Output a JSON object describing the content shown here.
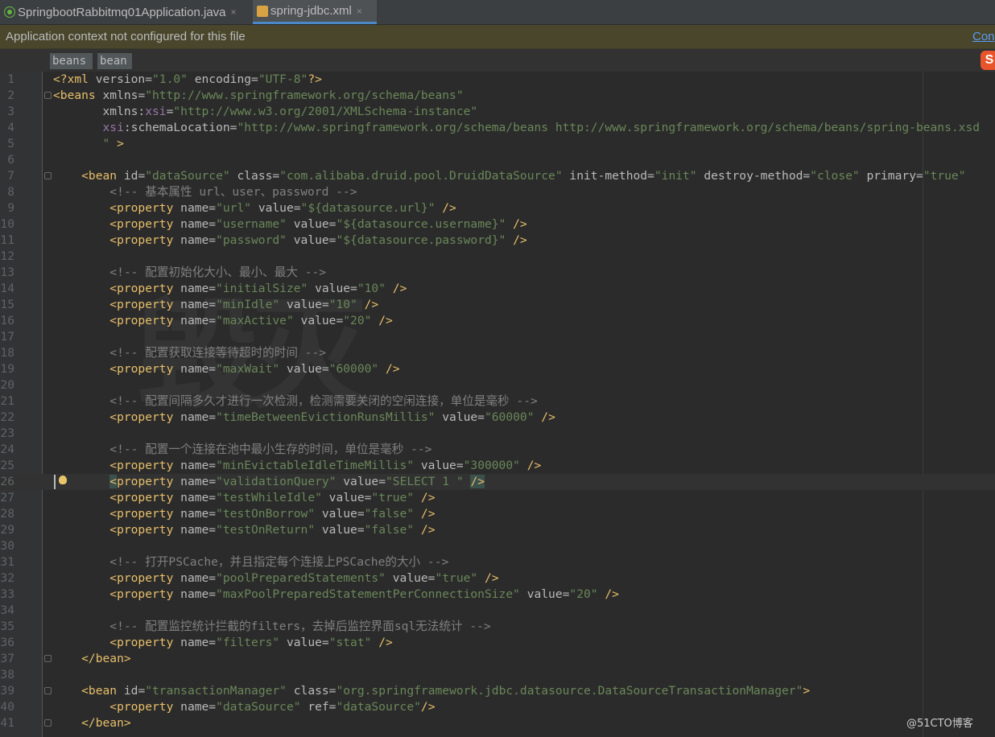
{
  "tabs": [
    {
      "label": "SpringbootRabbitmq01Application.java",
      "icon": "spring-boot-icon",
      "close": "×"
    },
    {
      "label": "spring-jdbc.xml",
      "icon": "xml-file-icon",
      "close": "×"
    }
  ],
  "notification": {
    "text": "Application context not configured for this file",
    "link": "Con"
  },
  "breadcrumbs": [
    "beans",
    "bean"
  ],
  "sogou_label": "S",
  "watermark_text": "毁灭",
  "credit": "@51CTO博客",
  "code_lines": [
    {
      "n": "1",
      "toks": [
        [
          "tag",
          "<?xml "
        ],
        [
          "attr",
          "version="
        ],
        [
          "val",
          "\"1.0\""
        ],
        [
          "attr",
          " encoding="
        ],
        [
          "val",
          "\"UTF-8\""
        ],
        [
          "tag",
          "?>"
        ]
      ]
    },
    {
      "n": "2",
      "fold": true,
      "toks": [
        [
          "tag",
          "<beans "
        ],
        [
          "attr",
          "xmlns="
        ],
        [
          "val",
          "\"http://www.springframework.org/schema/beans\""
        ]
      ]
    },
    {
      "n": "3",
      "toks": [
        [
          "attr",
          "       xmlns:"
        ],
        [
          "ns",
          "xsi"
        ],
        [
          "attr",
          "="
        ],
        [
          "val",
          "\"http://www.w3.org/2001/XMLSchema-instance\""
        ]
      ]
    },
    {
      "n": "4",
      "toks": [
        [
          "ns",
          "       xsi"
        ],
        [
          "attr",
          ":schemaLocation="
        ],
        [
          "val",
          "\"http://www.springframework.org/schema/beans http://www.springframework.org/schema/beans/spring-beans.xsd"
        ]
      ]
    },
    {
      "n": "5",
      "toks": [
        [
          "val",
          "       \" "
        ],
        [
          "tag",
          ">"
        ]
      ]
    },
    {
      "n": "6",
      "toks": []
    },
    {
      "n": "7",
      "fold": true,
      "toks": [
        [
          "tag",
          "    <bean "
        ],
        [
          "attr",
          "id="
        ],
        [
          "val",
          "\"dataSource\""
        ],
        [
          "attr",
          " class="
        ],
        [
          "val",
          "\"com.alibaba.druid.pool.DruidDataSource\""
        ],
        [
          "attr",
          " init-method="
        ],
        [
          "val",
          "\"init\""
        ],
        [
          "attr",
          " destroy-method="
        ],
        [
          "val",
          "\"close\""
        ],
        [
          "attr",
          " primary="
        ],
        [
          "val",
          "\"true\""
        ]
      ]
    },
    {
      "n": "8",
      "toks": [
        [
          "com",
          "        <!-- 基本属性 url、user、password -->"
        ]
      ]
    },
    {
      "n": "9",
      "toks": [
        [
          "tag",
          "        <property "
        ],
        [
          "attr",
          "name="
        ],
        [
          "val",
          "\"url\""
        ],
        [
          "attr",
          " value="
        ],
        [
          "val",
          "\"${datasource.url}\""
        ],
        [
          "tag",
          " />"
        ]
      ]
    },
    {
      "n": "10",
      "toks": [
        [
          "tag",
          "        <property "
        ],
        [
          "attr",
          "name="
        ],
        [
          "val",
          "\"username\""
        ],
        [
          "attr",
          " value="
        ],
        [
          "val",
          "\"${datasource.username}\""
        ],
        [
          "tag",
          " />"
        ]
      ]
    },
    {
      "n": "11",
      "toks": [
        [
          "tag",
          "        <property "
        ],
        [
          "attr",
          "name="
        ],
        [
          "val",
          "\"password\""
        ],
        [
          "attr",
          " value="
        ],
        [
          "val",
          "\"${datasource.password}\""
        ],
        [
          "tag",
          " />"
        ]
      ]
    },
    {
      "n": "12",
      "toks": []
    },
    {
      "n": "13",
      "toks": [
        [
          "com",
          "        <!-- 配置初始化大小、最小、最大 -->"
        ]
      ]
    },
    {
      "n": "14",
      "toks": [
        [
          "tag",
          "        <property "
        ],
        [
          "attr",
          "name="
        ],
        [
          "val",
          "\"initialSize\""
        ],
        [
          "attr",
          " value="
        ],
        [
          "val",
          "\"10\""
        ],
        [
          "tag",
          " />"
        ]
      ]
    },
    {
      "n": "15",
      "toks": [
        [
          "tag",
          "        <property "
        ],
        [
          "attr",
          "name="
        ],
        [
          "val",
          "\"minIdle\""
        ],
        [
          "attr",
          " value="
        ],
        [
          "val",
          "\"10\""
        ],
        [
          "tag",
          " />"
        ]
      ]
    },
    {
      "n": "16",
      "toks": [
        [
          "tag",
          "        <property "
        ],
        [
          "attr",
          "name="
        ],
        [
          "val",
          "\"maxActive\""
        ],
        [
          "attr",
          " value="
        ],
        [
          "val",
          "\"20\""
        ],
        [
          "tag",
          " />"
        ]
      ]
    },
    {
      "n": "17",
      "toks": []
    },
    {
      "n": "18",
      "toks": [
        [
          "com",
          "        <!-- 配置获取连接等待超时的时间 -->"
        ]
      ]
    },
    {
      "n": "19",
      "toks": [
        [
          "tag",
          "        <property "
        ],
        [
          "attr",
          "name="
        ],
        [
          "val",
          "\"maxWait\""
        ],
        [
          "attr",
          " value="
        ],
        [
          "val",
          "\"60000\""
        ],
        [
          "tag",
          " />"
        ]
      ]
    },
    {
      "n": "20",
      "toks": []
    },
    {
      "n": "21",
      "toks": [
        [
          "com",
          "        <!-- 配置间隔多久才进行一次检测，检测需要关闭的空闲连接，单位是毫秒 -->"
        ]
      ]
    },
    {
      "n": "22",
      "toks": [
        [
          "tag",
          "        <property "
        ],
        [
          "attr",
          "name="
        ],
        [
          "val",
          "\"timeBetweenEvictionRunsMillis\""
        ],
        [
          "attr",
          " value="
        ],
        [
          "val",
          "\"60000\""
        ],
        [
          "tag",
          " />"
        ]
      ]
    },
    {
      "n": "23",
      "toks": []
    },
    {
      "n": "24",
      "toks": [
        [
          "com",
          "        <!-- 配置一个连接在池中最小生存的时间，单位是毫秒 -->"
        ]
      ]
    },
    {
      "n": "25",
      "toks": [
        [
          "tag",
          "        <property "
        ],
        [
          "attr",
          "name="
        ],
        [
          "val",
          "\"minEvictableIdleTimeMillis\""
        ],
        [
          "attr",
          " value="
        ],
        [
          "val",
          "\"300000\""
        ],
        [
          "tag",
          " />"
        ]
      ]
    },
    {
      "n": "26",
      "current": true,
      "bulb": true,
      "toks": [
        [
          "plain",
          "        "
        ],
        [
          "hlt",
          "<"
        ],
        [
          "tag",
          "property "
        ],
        [
          "attr",
          "name="
        ],
        [
          "val",
          "\"validationQuery\""
        ],
        [
          "attr",
          " value="
        ],
        [
          "val",
          "\"SELECT 1 \""
        ],
        [
          "plain",
          " "
        ],
        [
          "hlt",
          "/>"
        ]
      ]
    },
    {
      "n": "27",
      "toks": [
        [
          "tag",
          "        <property "
        ],
        [
          "attr",
          "name="
        ],
        [
          "val",
          "\"testWhileIdle\""
        ],
        [
          "attr",
          " value="
        ],
        [
          "val",
          "\"true\""
        ],
        [
          "tag",
          " />"
        ]
      ]
    },
    {
      "n": "28",
      "toks": [
        [
          "tag",
          "        <property "
        ],
        [
          "attr",
          "name="
        ],
        [
          "val",
          "\"testOnBorrow\""
        ],
        [
          "attr",
          " value="
        ],
        [
          "val",
          "\"false\""
        ],
        [
          "tag",
          " />"
        ]
      ]
    },
    {
      "n": "29",
      "toks": [
        [
          "tag",
          "        <property "
        ],
        [
          "attr",
          "name="
        ],
        [
          "val",
          "\"testOnReturn\""
        ],
        [
          "attr",
          " value="
        ],
        [
          "val",
          "\"false\""
        ],
        [
          "tag",
          " />"
        ]
      ]
    },
    {
      "n": "30",
      "toks": []
    },
    {
      "n": "31",
      "toks": [
        [
          "com",
          "        <!-- 打开PSCache，并且指定每个连接上PSCache的大小 -->"
        ]
      ]
    },
    {
      "n": "32",
      "toks": [
        [
          "tag",
          "        <property "
        ],
        [
          "attr",
          "name="
        ],
        [
          "val",
          "\"poolPreparedStatements\""
        ],
        [
          "attr",
          " value="
        ],
        [
          "val",
          "\"true\""
        ],
        [
          "tag",
          " />"
        ]
      ]
    },
    {
      "n": "33",
      "toks": [
        [
          "tag",
          "        <property "
        ],
        [
          "attr",
          "name="
        ],
        [
          "val",
          "\"maxPoolPreparedStatementPerConnectionSize\""
        ],
        [
          "attr",
          " value="
        ],
        [
          "val",
          "\"20\""
        ],
        [
          "tag",
          " />"
        ]
      ]
    },
    {
      "n": "34",
      "toks": []
    },
    {
      "n": "35",
      "toks": [
        [
          "com",
          "        <!-- 配置监控统计拦截的filters，去掉后监控界面sql无法统计 -->"
        ]
      ]
    },
    {
      "n": "36",
      "toks": [
        [
          "tag",
          "        <property "
        ],
        [
          "attr",
          "name="
        ],
        [
          "val",
          "\"filters\""
        ],
        [
          "attr",
          " value="
        ],
        [
          "val",
          "\"stat\""
        ],
        [
          "tag",
          " />"
        ]
      ]
    },
    {
      "n": "37",
      "fold": true,
      "toks": [
        [
          "tag",
          "    </bean>"
        ]
      ]
    },
    {
      "n": "38",
      "toks": []
    },
    {
      "n": "39",
      "fold": true,
      "toks": [
        [
          "tag",
          "    <bean "
        ],
        [
          "attr",
          "id="
        ],
        [
          "val",
          "\"transactionManager\""
        ],
        [
          "attr",
          " class="
        ],
        [
          "val",
          "\"org.springframework.jdbc.datasource.DataSourceTransactionManager\""
        ],
        [
          "tag",
          ">"
        ]
      ]
    },
    {
      "n": "40",
      "toks": [
        [
          "tag",
          "        <property "
        ],
        [
          "attr",
          "name="
        ],
        [
          "val",
          "\"dataSource\""
        ],
        [
          "attr",
          " ref="
        ],
        [
          "val",
          "\"dataSource\""
        ],
        [
          "tag",
          "/>"
        ]
      ]
    },
    {
      "n": "41",
      "fold": true,
      "toks": [
        [
          "tag",
          "    </bean>"
        ]
      ]
    }
  ]
}
